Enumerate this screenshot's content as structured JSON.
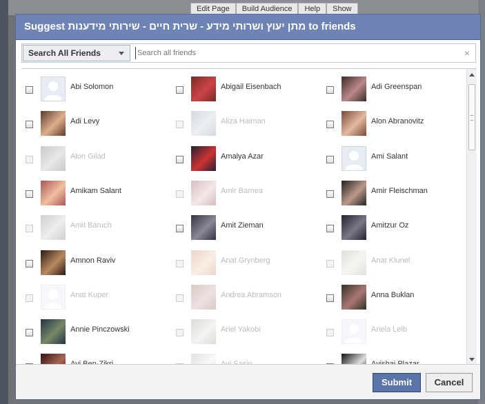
{
  "background": {
    "tabs": [
      "Edit Page",
      "Build Audience",
      "Help",
      "Show"
    ]
  },
  "dialog": {
    "title": "Suggest מתן יעוץ ושרותי מידע - שרית חיים - שירותי מידענות to friends"
  },
  "search": {
    "filter_label": "Search All Friends",
    "placeholder": "Search all friends",
    "clear_glyph": "×"
  },
  "friends": [
    {
      "name": "Abi Solomon",
      "enabled": true,
      "avatar": "default"
    },
    {
      "name": "Abigail Eisenbach",
      "enabled": true,
      "avatar": "photo"
    },
    {
      "name": "Adi Greenspan",
      "enabled": true,
      "avatar": "photo"
    },
    {
      "name": "Adi Levy",
      "enabled": true,
      "avatar": "photo"
    },
    {
      "name": "Aliza Haiman",
      "enabled": false,
      "avatar": "photo"
    },
    {
      "name": "Alon Abranovitz",
      "enabled": true,
      "avatar": "photo"
    },
    {
      "name": "Alon Gilad",
      "enabled": false,
      "avatar": "photo"
    },
    {
      "name": "Amalya Azar",
      "enabled": true,
      "avatar": "photo"
    },
    {
      "name": "Ami Salant",
      "enabled": true,
      "avatar": "default"
    },
    {
      "name": "Amikam Salant",
      "enabled": true,
      "avatar": "photo"
    },
    {
      "name": "Amir Barnea",
      "enabled": false,
      "avatar": "photo"
    },
    {
      "name": "Amir Fleischman",
      "enabled": true,
      "avatar": "photo"
    },
    {
      "name": "Amit Baruch",
      "enabled": false,
      "avatar": "photo"
    },
    {
      "name": "Amit Zieman",
      "enabled": true,
      "avatar": "photo"
    },
    {
      "name": "Amitzur Oz",
      "enabled": true,
      "avatar": "photo"
    },
    {
      "name": "Amnon Raviv",
      "enabled": true,
      "avatar": "photo"
    },
    {
      "name": "Anat Grynberg",
      "enabled": false,
      "avatar": "photo"
    },
    {
      "name": "Anat Klunel",
      "enabled": false,
      "avatar": "photo"
    },
    {
      "name": "Anat Kuper",
      "enabled": false,
      "avatar": "default"
    },
    {
      "name": "Andrea Abramson",
      "enabled": false,
      "avatar": "photo"
    },
    {
      "name": "Anna Buklan",
      "enabled": true,
      "avatar": "photo"
    },
    {
      "name": "Annie Pinczowski",
      "enabled": true,
      "avatar": "photo"
    },
    {
      "name": "Ariel Yakobi",
      "enabled": false,
      "avatar": "photo"
    },
    {
      "name": "Ariela Leib",
      "enabled": false,
      "avatar": "default"
    },
    {
      "name": "Avi Ben-Zikri",
      "enabled": true,
      "avatar": "photo"
    },
    {
      "name": "Avi Sasin",
      "enabled": false,
      "avatar": "photo"
    },
    {
      "name": "Avishai Plazar",
      "enabled": true,
      "avatar": "photo"
    }
  ],
  "footer": {
    "submit_label": "Submit",
    "cancel_label": "Cancel"
  },
  "colors": {
    "title_bg": "#6d84b4",
    "submit_bg": "#5b74a8"
  }
}
